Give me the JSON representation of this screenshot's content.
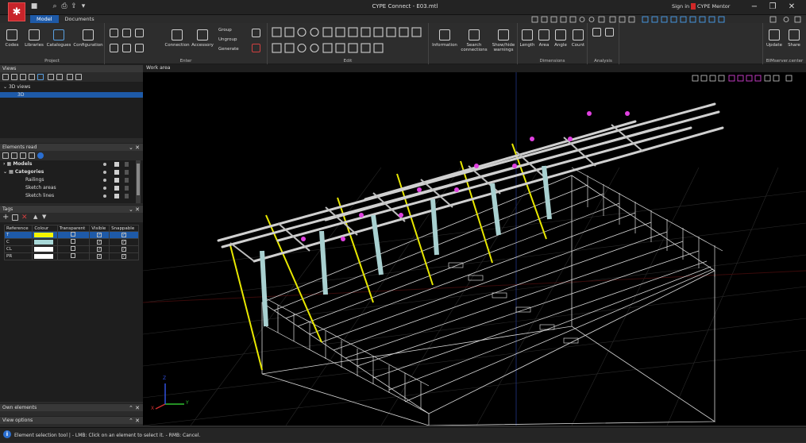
{
  "app": {
    "title": "CYPE Connect - E03.mtl",
    "sign_in": "Sign in",
    "mentor": "CYPE Mentor",
    "minimize": "−",
    "restore": "❐",
    "close": "✕"
  },
  "tabs": [
    "Model",
    "Documents"
  ],
  "ribbon": {
    "project": {
      "label": "Project",
      "buttons": [
        "Codes",
        "Libraries",
        "Catalogues",
        "Configuration"
      ]
    },
    "enter": {
      "label": "Enter",
      "buttons": [
        "Connection",
        "Accessory"
      ],
      "group": "Group",
      "ungroup": "Ungroup",
      "generate": "Generate"
    },
    "edit": {
      "label": "Edit"
    },
    "info": {
      "buttons": [
        "Information",
        "Search connections",
        "Show/hide warnings"
      ]
    },
    "dimensions": {
      "label": "Dimensions",
      "buttons": [
        "Length",
        "Area",
        "Angle",
        "Count"
      ]
    },
    "analysis": {
      "label": "Analysis"
    },
    "bim": {
      "label": "BIMserver.center",
      "buttons": [
        "Update",
        "Share"
      ]
    }
  },
  "views": {
    "title": "Views",
    "tree_root": "3D views",
    "tree_item": "3D"
  },
  "elements_read": {
    "title": "Elements read",
    "items": [
      "Models",
      "Categories",
      "Railings",
      "Sketch areas",
      "Sketch lines"
    ]
  },
  "tags": {
    "title": "Tags",
    "columns": [
      "Reference",
      "Colour",
      "Transparent",
      "Visible",
      "Snappable"
    ],
    "rows": [
      {
        "ref": "T",
        "colour": "#f5f500",
        "transparent": false,
        "visible": true,
        "snappable": true
      },
      {
        "ref": "C",
        "colour": "#a8d8d8",
        "transparent": false,
        "visible": true,
        "snappable": true
      },
      {
        "ref": "CL",
        "colour": "#ffffff",
        "transparent": false,
        "visible": true,
        "snappable": true
      },
      {
        "ref": "PR",
        "colour": "#ffffff",
        "transparent": false,
        "visible": true,
        "snappable": true
      }
    ]
  },
  "own_elements": {
    "title": "Own elements"
  },
  "view_options": {
    "title": "View options"
  },
  "work": {
    "title": "Work area",
    "axis_x": "X",
    "axis_y": "Y",
    "axis_z": "Z"
  },
  "status": {
    "text": "Element selection tool | - LMB: Click on an element to select it. - RMB: Cancel."
  }
}
